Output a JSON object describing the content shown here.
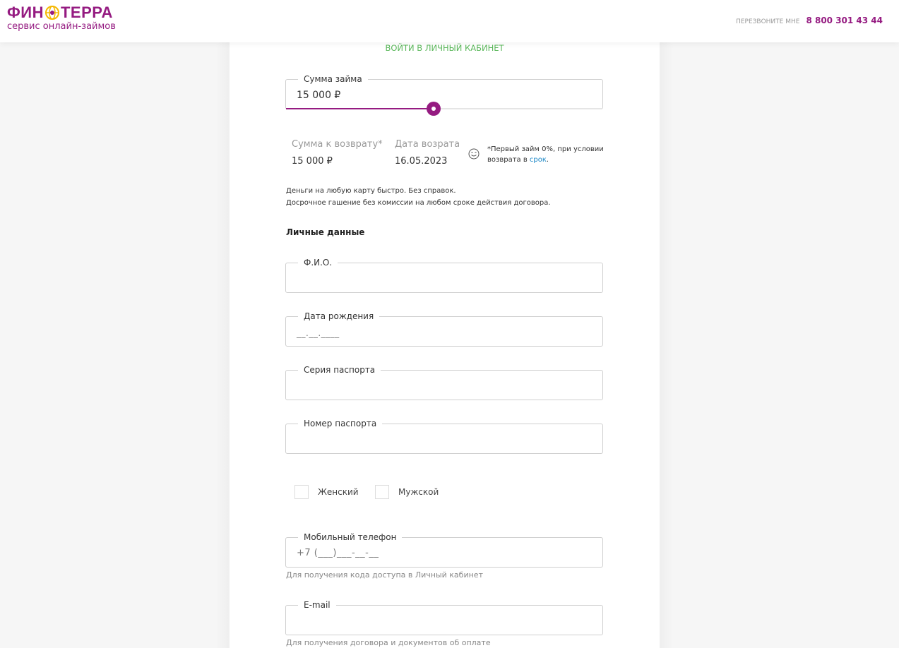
{
  "header": {
    "logo_left": "ФИН",
    "logo_right": "ТЕРРА",
    "logo_subtitle": "сервис онлайн-займов",
    "callback_label": "ПЕРЕЗВОНИТЕ МНЕ",
    "phone": "8 800 301 43 44"
  },
  "form": {
    "login_link": "ВОЙТИ В ЛИЧНЫЙ КАБИНЕТ",
    "loan": {
      "label": "Сумма займа",
      "value": "15 000 ₽",
      "slider_fraction": 0.466
    },
    "summary": {
      "return_label": "Сумма к возврату*",
      "return_value": "15 000 ₽",
      "date_label": "Дата возрата",
      "date_value": "16.05.2023",
      "note_text": "*Первый займ 0%, при условии возврата в ",
      "note_link": "срок",
      "note_end": "."
    },
    "info_line1": "Деньги на любую карту быстро. Без справок.",
    "info_line2": "Досрочное гашение без комиссии на любом сроке действия договора.",
    "personal_title": "Личные данные",
    "fields": {
      "fio_label": "Ф.И.О.",
      "birth_label": "Дата рождения",
      "birth_placeholder": "__.__.____",
      "passport_series_label": "Серия паспорта",
      "passport_number_label": "Номер паспорта",
      "phone_label": "Мобильный телефон",
      "phone_placeholder": "+7 (___)___-__-__",
      "phone_hint": "Для получения кода доступа в Личный кабинет",
      "email_label": "E-mail",
      "email_hint": "Для получения договора и документов об оплате"
    },
    "gender": {
      "female": "Женский",
      "male": "Мужской"
    }
  },
  "colors": {
    "brand": "#951b81",
    "accent_green": "#5cb85c",
    "link": "#1e88c7",
    "globe": "#f5b800"
  }
}
